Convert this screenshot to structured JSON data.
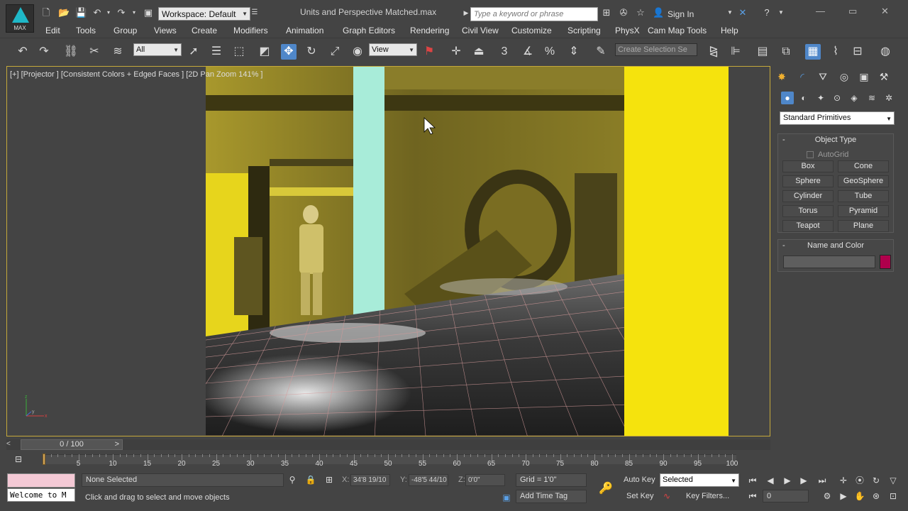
{
  "app": {
    "logo_text": "MAX",
    "workspace": "Workspace: Default",
    "file_title": "Units and Perspective Matched.max",
    "search_placeholder": "Type a keyword or phrase",
    "sign_in": "Sign In"
  },
  "menu": [
    "Edit",
    "Tools",
    "Group",
    "Views",
    "Create",
    "Modifiers",
    "Animation",
    "Graph Editors",
    "Rendering",
    "Civil View",
    "Customize",
    "Scripting",
    "PhysX",
    "Cam Map Tools",
    "Help"
  ],
  "toolbar": {
    "filter_value": "All",
    "ref_coord_value": "View",
    "selection_set_placeholder": "Create Selection Se"
  },
  "viewport": {
    "label": "[+] [Projector ] [Consistent Colors + Edged Faces ]",
    "pan_zoom": "[2D Pan Zoom 141% ]",
    "colors": {
      "yellow": "#f5e30d",
      "cyan": "#a8ecd9",
      "scene_tint": "#b9a93a"
    }
  },
  "command_panel": {
    "dropdown_value": "Standard Primitives",
    "object_type_title": "Object Type",
    "autogrid_label": "AutoGrid",
    "primitives": [
      "Box",
      "Cone",
      "Sphere",
      "GeoSphere",
      "Cylinder",
      "Tube",
      "Torus",
      "Pyramid",
      "Teapot",
      "Plane"
    ],
    "name_color_title": "Name and Color",
    "object_color": "#b0004c"
  },
  "timeline": {
    "position": "0 / 100",
    "ticks": [
      "0",
      "5",
      "10",
      "15",
      "20",
      "25",
      "30",
      "35",
      "40",
      "45",
      "50",
      "55",
      "60",
      "65",
      "70",
      "75",
      "80",
      "85",
      "90",
      "95",
      "100"
    ]
  },
  "status": {
    "listener_text": "Welcome to M",
    "selection": "None Selected",
    "prompt": "Click and drag to select and move objects",
    "x_label": "X:",
    "x_value": "34'8 19/10",
    "y_label": "Y:",
    "y_value": "-48'5 44/10",
    "z_label": "Z:",
    "z_value": "0'0\"",
    "grid": "Grid = 1'0\"",
    "add_time_tag": "Add Time Tag",
    "auto_key": "Auto Key",
    "set_key": "Set Key",
    "key_mode_value": "Selected",
    "key_filters": "Key Filters...",
    "current_frame": "0"
  }
}
